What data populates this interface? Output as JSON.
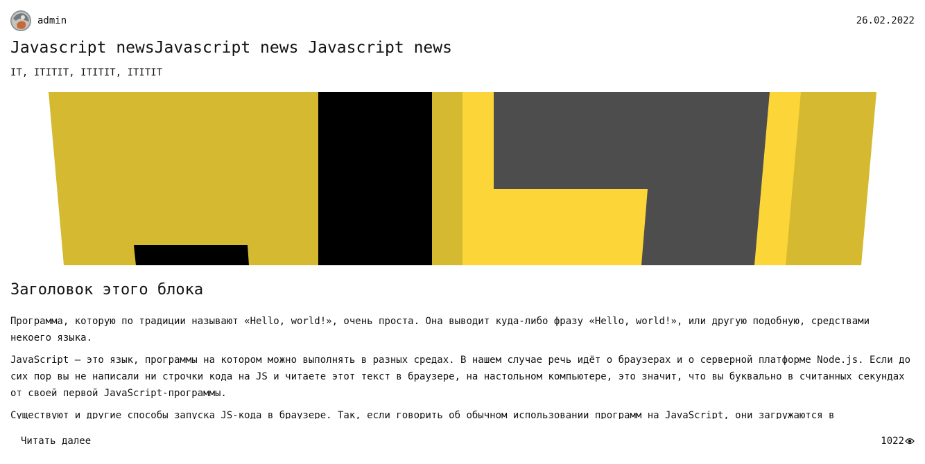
{
  "post": {
    "author": "admin",
    "date": "26.02.2022",
    "title": "Javascript newsJavascript news Javascript news",
    "tags": "IT, ITITIT, ITITIT, ITITIT",
    "block_heading": "Заголовок этого блока",
    "paragraphs": [
      "Программа, которую по традиции называют «Hello, world!», очень проста. Она выводит куда-либо фразу «Hello, world!», или другую подобную, средствами некоего языка.",
      "JavaScript — это язык, программы на котором можно выполнять в разных средах. В нашем случае речь идёт о браузерах и о серверной платформе Node.js. Если до сих пор вы не написали ни строчки кода на JS и читаете этот текст в браузере, на настольном компьютере, это значит, что вы буквально в считанных секундах от своей первой JavaScript-программы.",
      "Существуют и другие способы запуска JS-кода в браузере. Так, если говорить об обычном использовании программ на JavaScript, они загружаются в"
    ],
    "read_more_label": "Читать далее",
    "views": "1022"
  },
  "icons": {
    "avatar": "avatar",
    "views": "eye-icon"
  },
  "colors": {
    "logo_yellow": "#d4b931",
    "logo_yellow_light": "#fcd638",
    "logo_black": "#000000",
    "logo_gray": "#4d4d4d"
  }
}
